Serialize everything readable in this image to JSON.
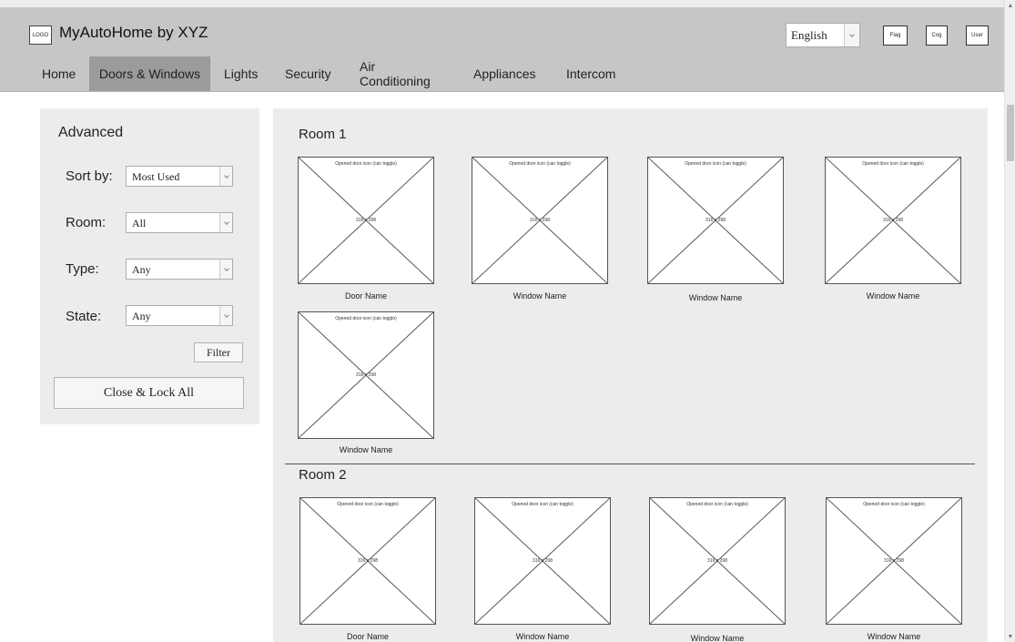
{
  "header": {
    "logo_text": "LOGO",
    "app_title": "MyAutoHome by XYZ",
    "language": "English",
    "flag_label": "Flag",
    "cog_label": "Cog",
    "user_label": "User"
  },
  "nav": {
    "items": [
      {
        "label": "Home"
      },
      {
        "label": "Doors & Windows",
        "active": true
      },
      {
        "label": "Lights"
      },
      {
        "label": "Security"
      },
      {
        "label": "Air Conditioning"
      },
      {
        "label": "Appliances"
      },
      {
        "label": "Intercom"
      }
    ]
  },
  "sidebar": {
    "title": "Advanced",
    "filters": [
      {
        "label": "Sort by:",
        "value": "Most Used"
      },
      {
        "label": "Room:",
        "value": "All"
      },
      {
        "label": "Type:",
        "value": "Any"
      },
      {
        "label": "State:",
        "value": "Any"
      }
    ],
    "filter_button": "Filter",
    "close_lock_button": "Close & Lock All"
  },
  "rooms": [
    {
      "title": "Room 1",
      "items": [
        {
          "icon_caption": "Opened door icon (can toggle)",
          "size_text": "316 x 298",
          "name": "Door Name"
        },
        {
          "icon_caption": "Opened door icon (can toggle)",
          "size_text": "316 x 298",
          "name": "Window Name"
        },
        {
          "icon_caption": "Opened door icon (can toggle)",
          "size_text": "316 x 298",
          "name": "Window Name"
        },
        {
          "icon_caption": "Opened door icon (can toggle)",
          "size_text": "316 x 298",
          "name": "Window Name"
        },
        {
          "icon_caption": "Opened door icon (can toggle)",
          "size_text": "316 x 298",
          "name": "Window Name"
        }
      ]
    },
    {
      "title": "Room 2",
      "items": [
        {
          "icon_caption": "Opened door icon (can toggle)",
          "size_text": "316 x 298",
          "name": "Door Name"
        },
        {
          "icon_caption": "Opened door icon (can toggle)",
          "size_text": "316 x 298",
          "name": "Window Name"
        },
        {
          "icon_caption": "Opened door icon (can toggle)",
          "size_text": "316 x 298",
          "name": "Window Name"
        },
        {
          "icon_caption": "Opened door icon (can toggle)",
          "size_text": "316 x 298",
          "name": "Window Name"
        }
      ]
    }
  ]
}
